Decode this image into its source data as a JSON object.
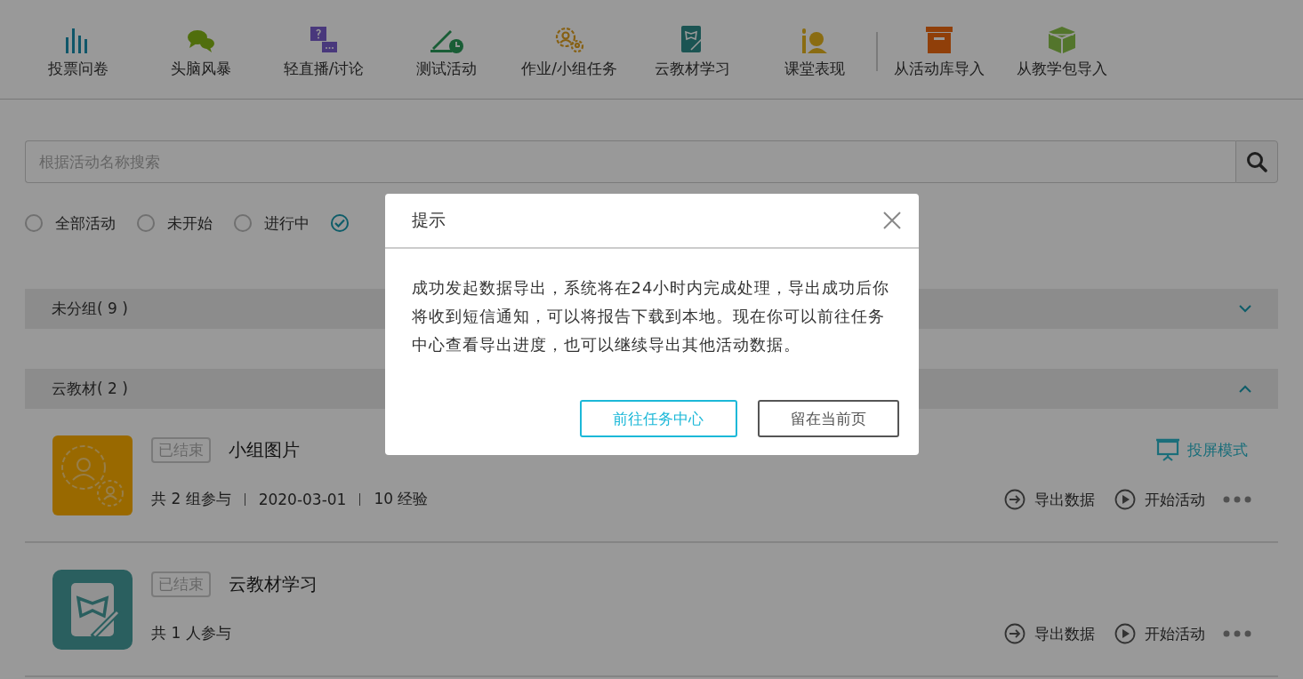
{
  "toolbar": {
    "tools": [
      {
        "label": "投票问卷"
      },
      {
        "label": "头脑风暴"
      },
      {
        "label": "轻直播/讨论"
      },
      {
        "label": "测试活动"
      },
      {
        "label": "作业/小组任务"
      },
      {
        "label": "云教材学习"
      },
      {
        "label": "课堂表现"
      }
    ],
    "imports": [
      {
        "label": "从活动库导入"
      },
      {
        "label": "从教学包导入"
      }
    ]
  },
  "search": {
    "placeholder": "根据活动名称搜索"
  },
  "filters": [
    {
      "label": "全部活动",
      "selected": false
    },
    {
      "label": "未开始",
      "selected": false
    },
    {
      "label": "进行中",
      "selected": false
    },
    {
      "selected": true
    }
  ],
  "groups": [
    {
      "title": "未分组( 9 )",
      "expanded": false
    },
    {
      "title": "云教材( 2 )",
      "expanded": true,
      "activities": [
        {
          "status": "已结束",
          "title": "小组图片",
          "meta": [
            "共 2 组参与",
            "2020-03-01",
            "10 经验"
          ],
          "projection": "投屏模式",
          "actions": [
            "导出数据",
            "开始活动"
          ]
        },
        {
          "status": "已结束",
          "title": "云教材学习",
          "meta": [
            "共 1 人参与"
          ],
          "actions": [
            "导出数据",
            "开始活动"
          ]
        }
      ]
    }
  ],
  "dialog": {
    "title": "提示",
    "message": "成功发起数据导出，系统将在24小时内完成处理，导出成功后你将收到短信通知，可以将报告下载到本地。现在你可以前往任务中心查看导出进度，也可以继续导出其他活动数据。",
    "buttons": [
      {
        "label": "前往任务中心",
        "kind": "primary"
      },
      {
        "label": "留在当前页",
        "kind": "secondary"
      }
    ]
  }
}
